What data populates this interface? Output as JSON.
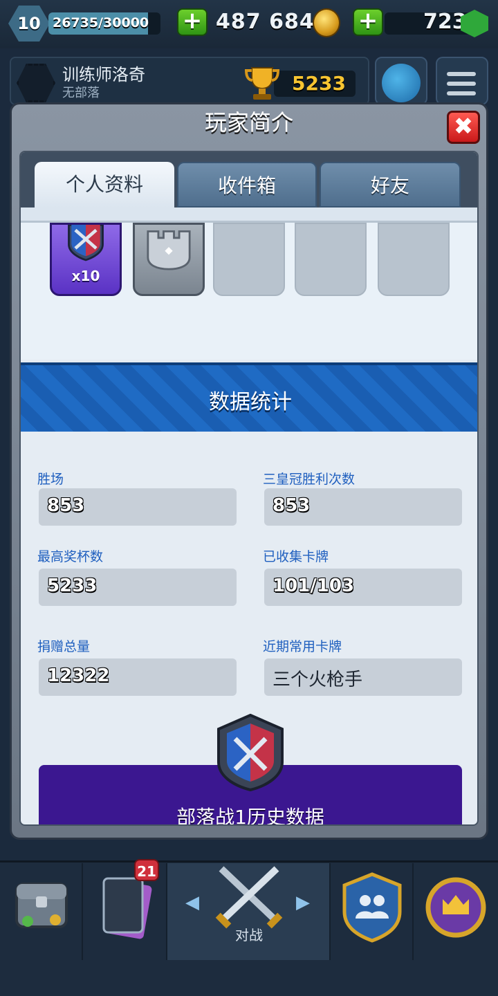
{
  "topbar": {
    "level": "10",
    "xp": "26735/30000",
    "xp_progress": 0.89,
    "gold": "487 684",
    "gems": "723",
    "plus_icon": "+"
  },
  "player": {
    "name": "训练师洛奇",
    "clan": "无部落",
    "trophies": "5233"
  },
  "modal": {
    "title": "玩家简介",
    "close_icon": "✖",
    "tabs": [
      {
        "label": "个人资料"
      },
      {
        "label": "收件箱"
      },
      {
        "label": "好友"
      }
    ],
    "badges": {
      "first_badge_count": "x10"
    },
    "stats_title": "数据统计",
    "stats": [
      {
        "label": "胜场",
        "value": "853"
      },
      {
        "label": "三皇冠胜利次数",
        "value": "853"
      },
      {
        "label": "最高奖杯数",
        "value": "5233"
      },
      {
        "label": "已收集卡牌",
        "value": "101/103"
      },
      {
        "label": "捐赠总量",
        "value": "12322"
      },
      {
        "label": "近期常用卡牌",
        "value": "三个火枪手"
      }
    ],
    "war_title": "部落战1历史数据"
  },
  "bottom_nav": {
    "cards_badge": "21",
    "battle_label": "对战",
    "left_arrow": "◀",
    "right_arrow": "▶"
  }
}
